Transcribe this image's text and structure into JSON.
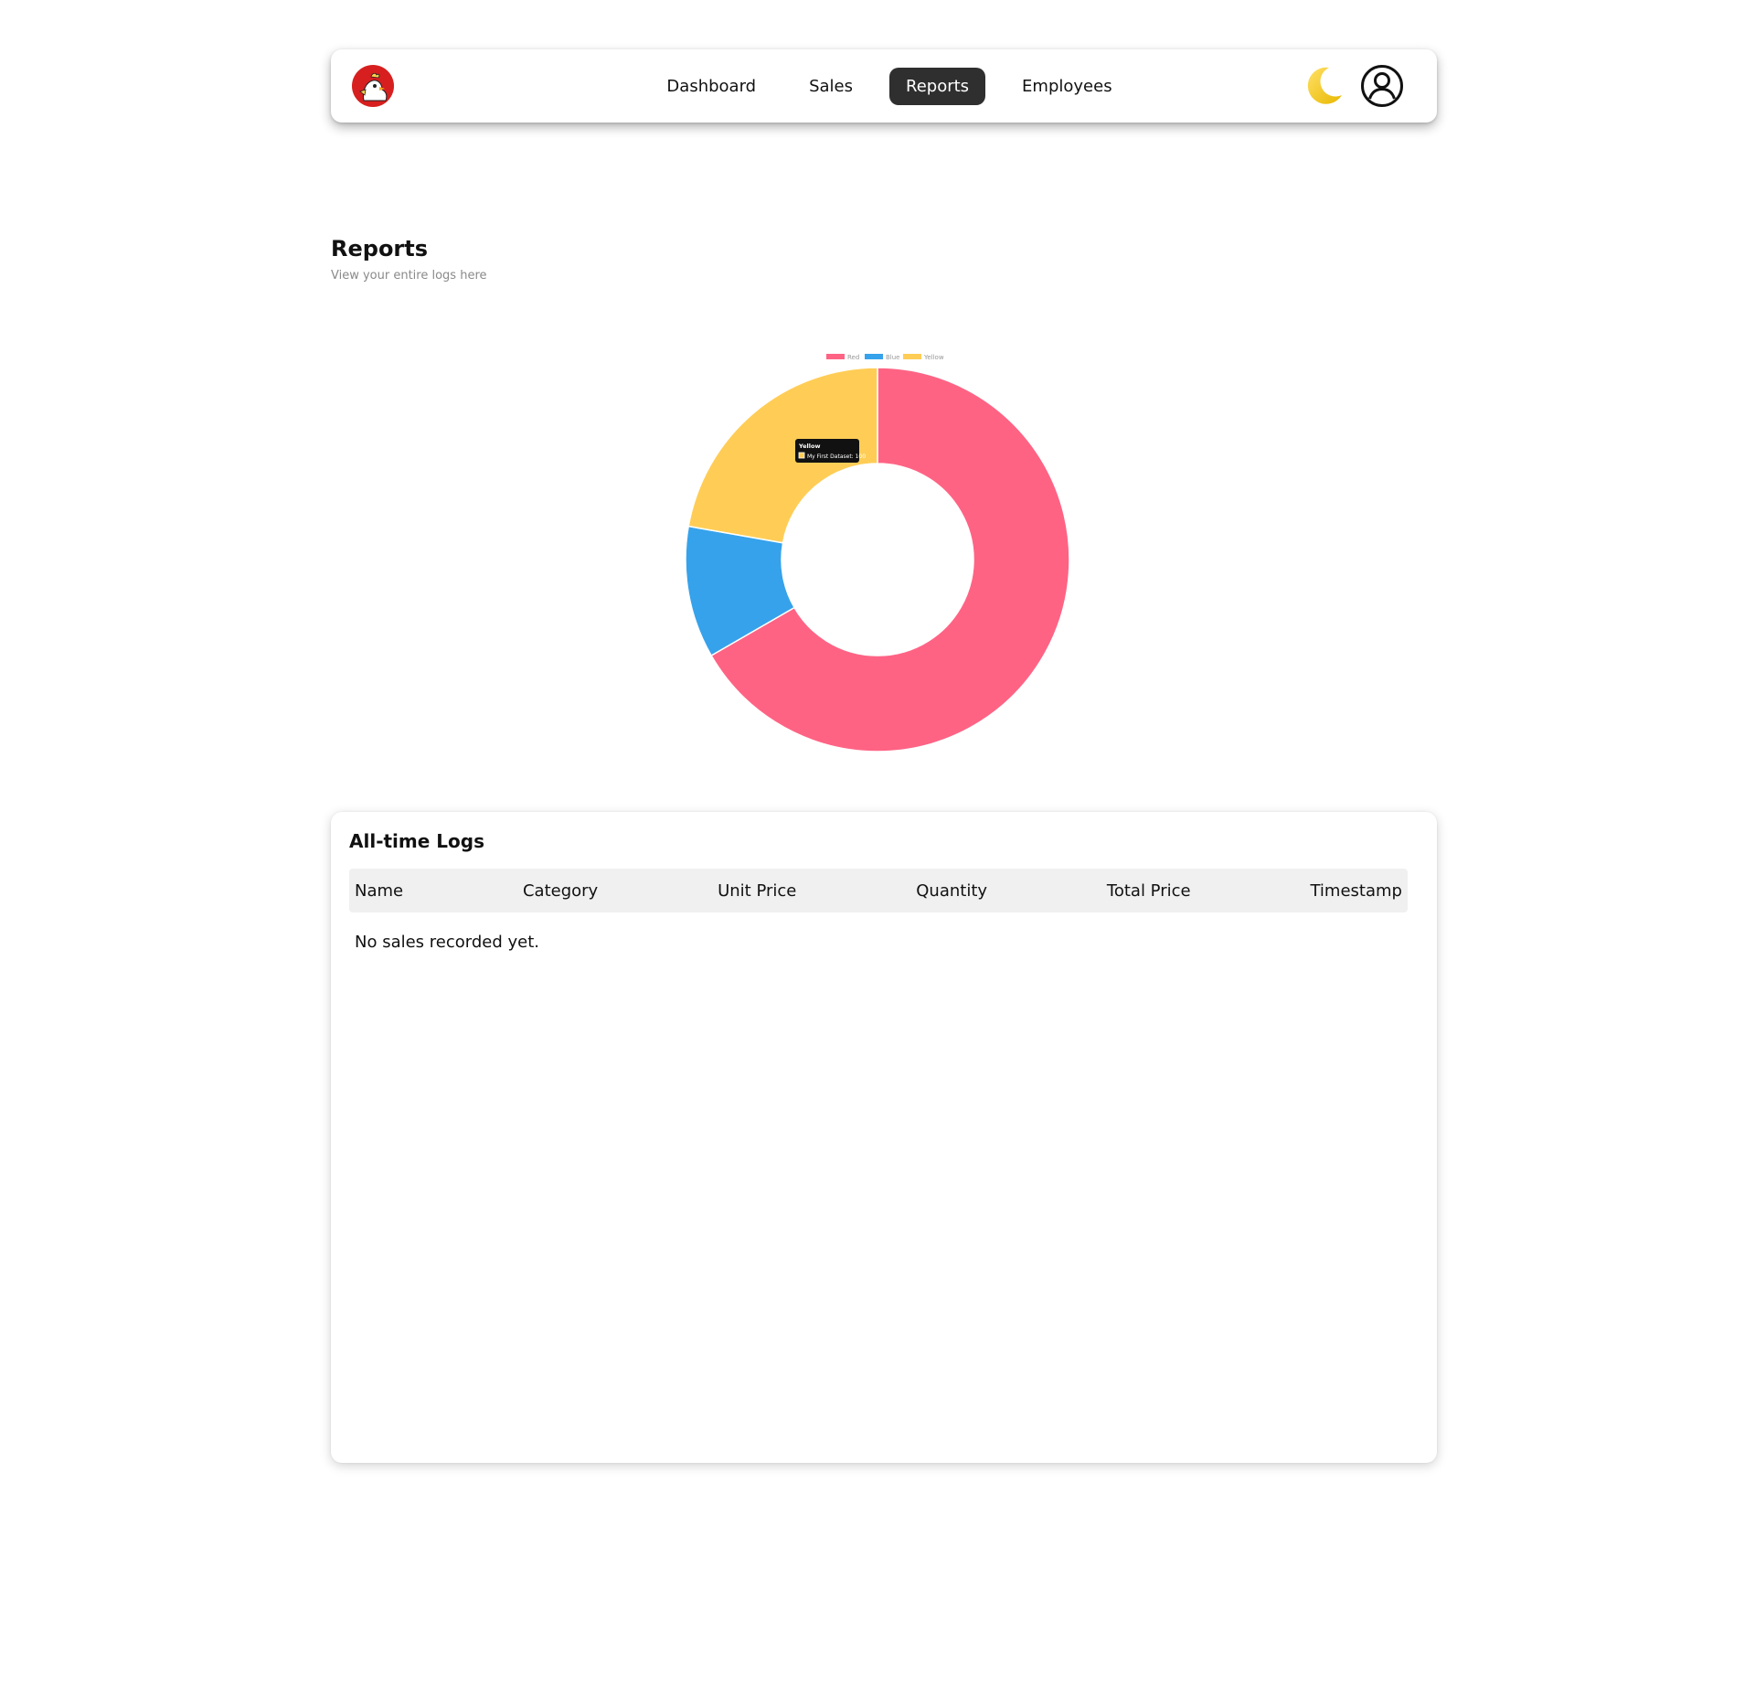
{
  "navbar": {
    "logo_icon": "chicken-mascot-logo",
    "items": [
      {
        "label": "Dashboard",
        "active": false
      },
      {
        "label": "Sales",
        "active": false
      },
      {
        "label": "Reports",
        "active": true
      },
      {
        "label": "Employees",
        "active": false
      }
    ],
    "theme_icon": "moon-icon",
    "profile_icon": "user-circle-icon"
  },
  "header": {
    "title": "Reports",
    "subtitle": "View your entire logs here"
  },
  "chart_data": {
    "type": "pie",
    "variant": "doughnut",
    "categories": [
      "Red",
      "Blue",
      "Yellow"
    ],
    "series": [
      {
        "name": "My First Dataset",
        "values": [
          300,
          50,
          100
        ]
      }
    ],
    "colors": [
      "#ff6384",
      "#36a2eb",
      "#ffcd56"
    ],
    "legend_position": "top",
    "tooltip": {
      "title": "Yellow",
      "label": "My First Dataset: 100"
    }
  },
  "logs": {
    "title": "All-time Logs",
    "columns": [
      "Name",
      "Category",
      "Unit Price",
      "Quantity",
      "Total Price",
      "Timestamp"
    ],
    "rows": [],
    "empty_message": "No sales recorded yet."
  }
}
